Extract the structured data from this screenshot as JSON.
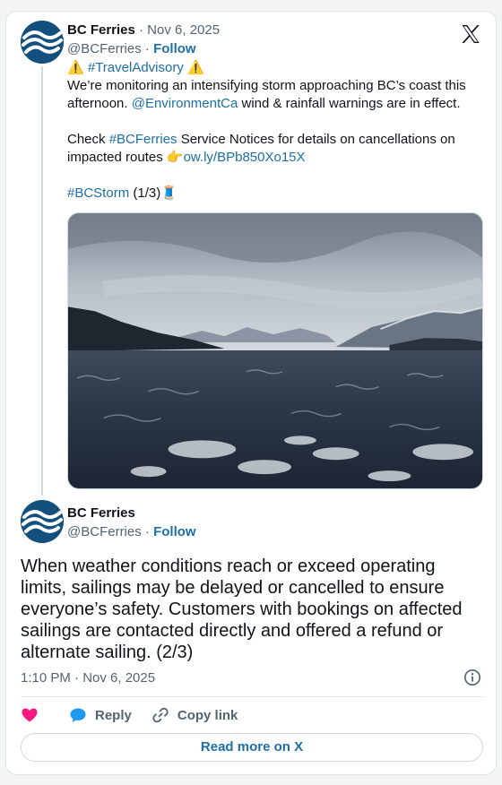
{
  "tweet1": {
    "display_name": "BC Ferries",
    "date_sep": " · ",
    "date": "Nov 6, 2025",
    "handle": "@BCFerries",
    "handle_sep": " · ",
    "follow_label": "Follow",
    "line1_warn_a": "⚠️",
    "line1_hashtag": "#TravelAdvisory",
    "line1_warn_b": "⚠️",
    "para1_a": "We’re monitoring an intensifying storm approaching BC’s coast this afternoon. ",
    "para1_mention": "@EnvironmentCa",
    "para1_b": " wind & rainfall warnings are in effect.",
    "para2_a": "Check ",
    "para2_hashtag": "#BCFerries",
    "para2_b": " Service Notices for details on cancellations on impacted routes ",
    "para2_emoji": "👉",
    "para2_link": "ow.ly/BPb850Xo15X",
    "para3_hashtag": "#BCStorm",
    "para3_count": " (1/3)",
    "para3_emoji": "🧵"
  },
  "tweet2": {
    "display_name": "BC Ferries",
    "handle": "@BCFerries",
    "handle_sep": " · ",
    "follow_label": "Follow",
    "text": "When weather conditions reach or exceed operating limits, sailings may be delayed or cancelled to ensure everyone’s safety. Customers with bookings on affected sailings are contacted directly and offered a refund or alternate sailing. (2/3)",
    "timestamp": "1:10 PM · Nov 6, 2025"
  },
  "actions": {
    "reply_label": "Reply",
    "copy_label": "Copy link"
  },
  "read_more_label": "Read more on X",
  "icons": {
    "platform_logo": "x-logo-icon",
    "avatar": "bc-ferries-wave-logo",
    "like": "heart-icon",
    "reply": "speech-bubble-icon",
    "copy": "link-icon",
    "info": "info-icon"
  },
  "colors": {
    "link": "#1d6fa5",
    "avatar_bg": "#13507d",
    "heart": "#f91880",
    "reply_bubble": "#1d9bf0"
  }
}
